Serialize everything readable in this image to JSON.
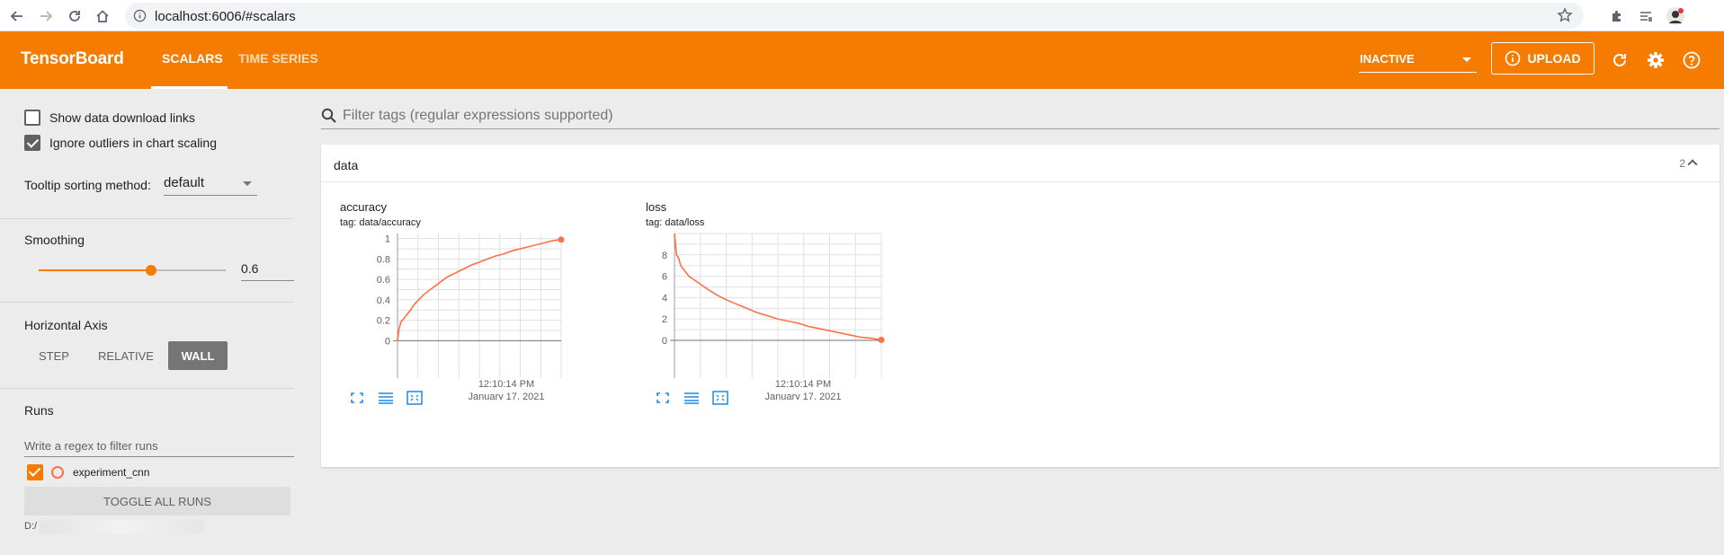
{
  "browser": {
    "url": "localhost:6006/#scalars"
  },
  "header": {
    "brand": "TensorBoard",
    "tabs": [
      {
        "label": "SCALARS",
        "active": true
      },
      {
        "label": "TIME SERIES",
        "active": false
      }
    ],
    "status": "INACTIVE",
    "upload_label": "UPLOAD",
    "accent_color": "#f57c00"
  },
  "sidebar": {
    "show_download_links": {
      "label": "Show data download links",
      "checked": false
    },
    "ignore_outliers": {
      "label": "Ignore outliers in chart scaling",
      "checked": true
    },
    "tooltip_sort": {
      "label": "Tooltip sorting method:",
      "value": "default"
    },
    "smoothing": {
      "label": "Smoothing",
      "value": "0.6",
      "fraction": 0.6
    },
    "horizontal_axis": {
      "label": "Horizontal Axis",
      "options": [
        "STEP",
        "RELATIVE",
        "WALL"
      ],
      "selected": "WALL"
    },
    "runs": {
      "label": "Runs",
      "filter_placeholder": "Write a regex to filter runs",
      "items": [
        {
          "name": "experiment_cnn",
          "checked": true,
          "color": "#ff7043"
        }
      ],
      "toggle_label": "TOGGLE ALL RUNS",
      "path_prefix": "D:/"
    }
  },
  "main": {
    "filter_placeholder": "Filter tags (regular expressions supported)",
    "group": {
      "title": "data",
      "count": "2"
    },
    "charts": [
      {
        "title": "accuracy",
        "tag": "tag: data/accuracy",
        "x_time": "12:10:14 PM",
        "x_date": "January 17, 2021"
      },
      {
        "title": "loss",
        "tag": "tag: data/loss",
        "x_time": "12:10:14 PM",
        "x_date": "January 17, 2021"
      }
    ]
  },
  "chart_data": [
    {
      "type": "line",
      "title": "accuracy",
      "xlabel": "",
      "ylabel": "",
      "x_tick_labels": [
        "12:10:14 PM",
        "January 17, 2021"
      ],
      "ylim": [
        -0.05,
        1.05
      ],
      "y_ticks": [
        0,
        0.2,
        0.4,
        0.6,
        0.8,
        1
      ],
      "grid": true,
      "color": "#ff7043",
      "x": [
        0,
        0.01,
        0.02,
        0.04,
        0.06,
        0.08,
        0.1,
        0.13,
        0.16,
        0.2,
        0.25,
        0.3,
        0.35,
        0.4,
        0.45,
        0.5,
        0.55,
        0.6,
        0.65,
        0.7,
        0.75,
        0.8,
        0.85,
        0.9,
        0.95,
        1.0
      ],
      "y": [
        0.0,
        0.12,
        0.18,
        0.22,
        0.26,
        0.3,
        0.35,
        0.4,
        0.45,
        0.5,
        0.56,
        0.62,
        0.66,
        0.7,
        0.74,
        0.77,
        0.8,
        0.83,
        0.85,
        0.88,
        0.9,
        0.92,
        0.94,
        0.96,
        0.98,
        0.99
      ]
    },
    {
      "type": "line",
      "title": "loss",
      "xlabel": "",
      "ylabel": "",
      "x_tick_labels": [
        "12:10:14 PM",
        "January 17, 2021"
      ],
      "ylim": [
        -0.5,
        10
      ],
      "y_ticks": [
        0,
        2,
        4,
        6,
        8
      ],
      "grid": true,
      "color": "#ff7043",
      "x": [
        0.0,
        0.01,
        0.02,
        0.03,
        0.05,
        0.07,
        0.1,
        0.13,
        0.16,
        0.2,
        0.25,
        0.3,
        0.35,
        0.4,
        0.45,
        0.5,
        0.55,
        0.6,
        0.65,
        0.7,
        0.75,
        0.8,
        0.85,
        0.9,
        0.95,
        1.0
      ],
      "y": [
        10.0,
        8.0,
        7.7,
        7.0,
        6.5,
        6.0,
        5.6,
        5.2,
        4.8,
        4.3,
        3.8,
        3.4,
        3.0,
        2.6,
        2.3,
        2.0,
        1.8,
        1.6,
        1.3,
        1.1,
        0.9,
        0.7,
        0.5,
        0.3,
        0.2,
        0.05
      ]
    }
  ]
}
